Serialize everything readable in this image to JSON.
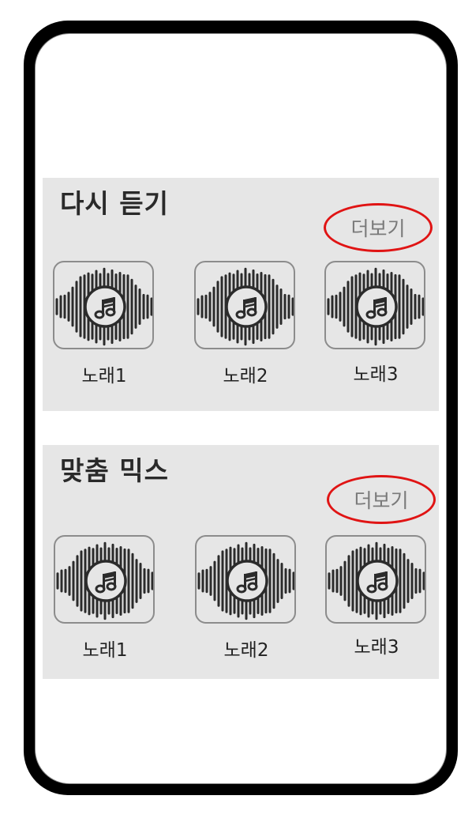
{
  "sections": [
    {
      "title": "다시 듣기",
      "more_label": "더보기",
      "songs": [
        {
          "label": "노래1",
          "icon": "music-waveform-icon"
        },
        {
          "label": "노래2",
          "icon": "music-waveform-icon"
        },
        {
          "label": "노래3",
          "icon": "music-waveform-icon"
        }
      ]
    },
    {
      "title": "맞춤 믹스",
      "more_label": "더보기",
      "songs": [
        {
          "label": "노래1",
          "icon": "music-waveform-icon"
        },
        {
          "label": "노래2",
          "icon": "music-waveform-icon"
        },
        {
          "label": "노래3",
          "icon": "music-waveform-icon"
        }
      ]
    }
  ],
  "colors": {
    "frame": "#000000",
    "section_bg": "#e6e6e6",
    "more_highlight": "#e01414",
    "more_text": "#7a7a7a",
    "title_text": "#2a2a2a"
  }
}
